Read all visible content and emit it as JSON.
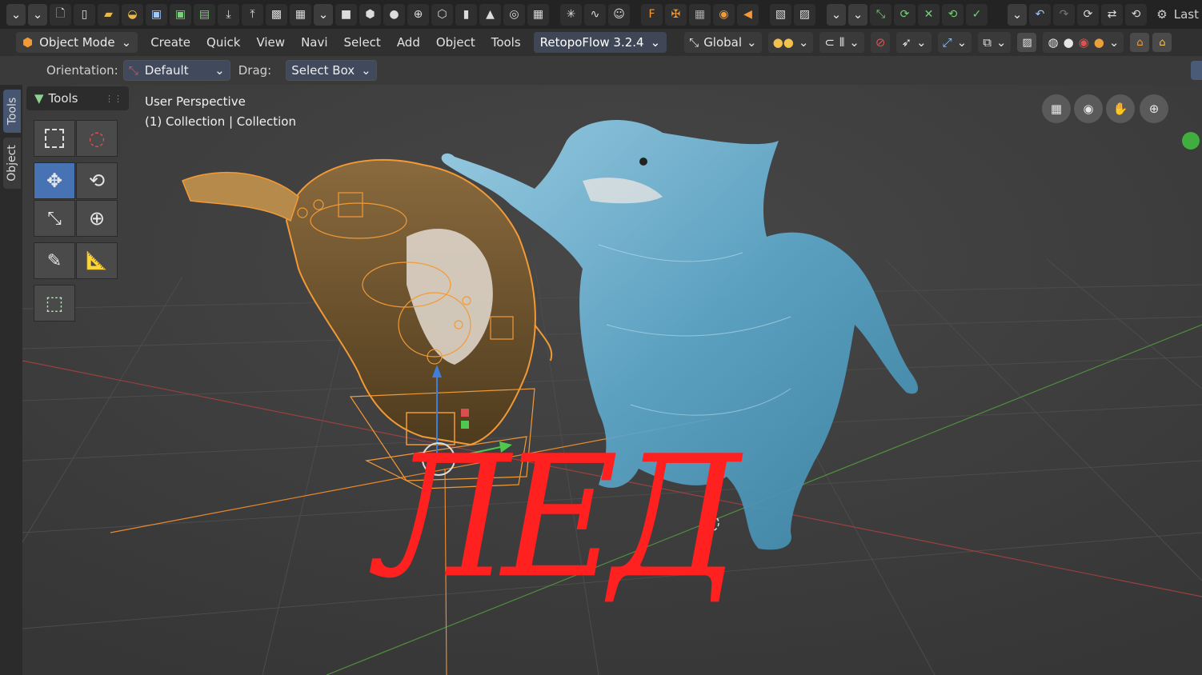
{
  "topbar": {
    "icons": [
      "dropdown-icon",
      "dropdown-icon",
      "new-file-icon",
      "file-icon",
      "open-folder-icon",
      "recent-folder-icon",
      "save-icon",
      "save-as-icon",
      "save-copy-icon",
      "import-icon",
      "export-icon",
      "render-image-icon",
      "render-anim-icon",
      "dropdown-icon",
      "cube-icon",
      "rounded-cube-icon",
      "sphere-icon",
      "uv-sphere-icon",
      "ico-sphere-icon",
      "cylinder-icon",
      "cone-icon",
      "torus-icon",
      "grid-icon",
      "empty-icon",
      "curve-icon",
      "monkey-icon",
      "text-icon",
      "armature-icon",
      "lattice-icon",
      "camera-icon",
      "speaker-icon",
      "image-editor-icon",
      "uv-editor-icon",
      "dropdown-icon",
      "dropdown-icon",
      "snap-icon",
      "loop-icon",
      "mirror-icon",
      "sync-icon",
      "check-icon",
      "dropdown-icon",
      "undo-icon",
      "redo-icon",
      "history-icon",
      "repeat-icon",
      "swap-icon"
    ],
    "last_label": "Last"
  },
  "header": {
    "mode": "Object Mode",
    "menus": [
      "Create",
      "Quick",
      "View",
      "Navi",
      "Select",
      "Add",
      "Object",
      "Tools"
    ],
    "retopoflow": "RetopoFlow 3.2.4",
    "transform_orientation": "Global"
  },
  "toolsettings": {
    "orientation_label": "Orientation:",
    "orientation_value": "Default",
    "drag_label": "Drag:",
    "drag_value": "Select Box"
  },
  "sidebar_tabs": [
    "Tools",
    "Object"
  ],
  "tools_panel": {
    "title": "Tools"
  },
  "viewport": {
    "perspective": "User Perspective",
    "collection": "(1) Collection | Collection",
    "overlay_word": "ЛЕД"
  },
  "colors": {
    "accent": "#4772b3",
    "overlay_word": "#ff2020",
    "selection": "#f29a36",
    "ice": "#6fb6d8"
  }
}
